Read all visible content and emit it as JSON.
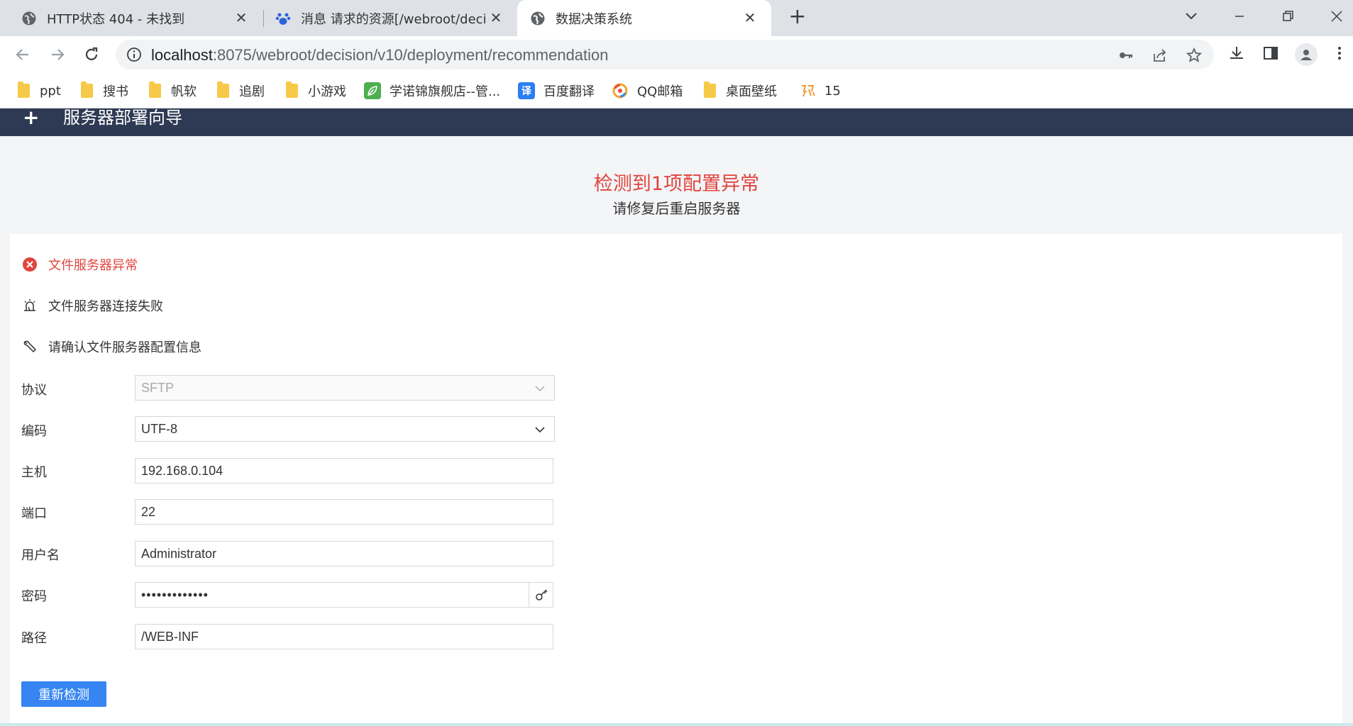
{
  "browser": {
    "tabs": [
      {
        "title": "HTTP状态 404 - 未找到",
        "icon": "globe-icon"
      },
      {
        "title": "消息 请求的资源[/webroot/deci",
        "icon": "baidu-paw-icon"
      },
      {
        "title": "数据决策系统",
        "icon": "globe-icon",
        "active": true
      }
    ],
    "url_host": "localhost",
    "url_path": ":8075/webroot/decision/v10/deployment/recommendation",
    "bookmarks": [
      {
        "label": "ppt",
        "icon": "folder-icon"
      },
      {
        "label": "搜书",
        "icon": "folder-icon"
      },
      {
        "label": "帆软",
        "icon": "folder-icon"
      },
      {
        "label": "追剧",
        "icon": "folder-icon"
      },
      {
        "label": "小游戏",
        "icon": "folder-icon"
      },
      {
        "label": "学诺锦旗舰店--管...",
        "icon": "leaf-icon"
      },
      {
        "label": "百度翻译",
        "icon": "translate-icon"
      },
      {
        "label": "QQ邮箱",
        "icon": "qqmail-icon"
      },
      {
        "label": "桌面壁纸",
        "icon": "folder-icon"
      },
      {
        "label": "15",
        "icon": "fan-icon"
      }
    ]
  },
  "page": {
    "header_logo": "+",
    "header_title": "服务器部署向导",
    "alert_title": "检测到1项配置异常",
    "alert_subtitle": "请修复后重启服务器",
    "error_title": "文件服务器异常",
    "error_reason": "文件服务器连接失败",
    "error_fix": "请确认文件服务器配置信息",
    "form": {
      "protocol_label": "协议",
      "protocol_value": "SFTP",
      "encoding_label": "编码",
      "encoding_value": "UTF-8",
      "host_label": "主机",
      "host_value": "192.168.0.104",
      "port_label": "端口",
      "port_value": "22",
      "username_label": "用户名",
      "username_value": "Administrator",
      "password_label": "密码",
      "password_value": "•••••••••••••",
      "path_label": "路径",
      "path_value": "/WEB-INF"
    },
    "recheck_label": "重新检测"
  },
  "colors": {
    "accent": "#3685f2",
    "error": "#e0443d",
    "header_bg": "#2e3a54"
  }
}
